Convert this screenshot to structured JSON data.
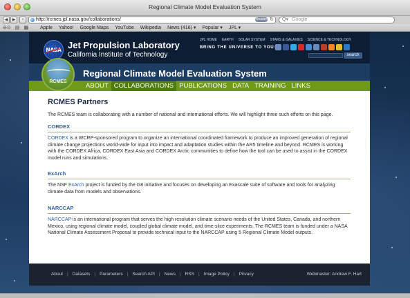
{
  "window": {
    "title": "Regional Climate Model Evaluation System"
  },
  "toolbar": {
    "url": "http://rcmes.jpl.nasa.gov/collaborations/",
    "reader_label": "Reader",
    "search_placeholder": "Google"
  },
  "bookmarks": [
    "Apple",
    "Yahoo!",
    "Google Maps",
    "YouTube",
    "Wikipedia",
    "News (416) ▾",
    "Popular ▾",
    "JPL ▾"
  ],
  "jpl": {
    "logo_text": "NASA",
    "title": "Jet Propulsion Laboratory",
    "subtitle": "California Institute of Technology",
    "top_links": [
      "JPL HOME",
      "EARTH",
      "SOLAR SYSTEM",
      "STARS & GALAXIES",
      "SCIENCE & TECHNOLOGY"
    ],
    "tagline": "BRING THE UNIVERSE TO YOU:",
    "search_button": "search"
  },
  "rcmes": {
    "logo_text": "RCMES",
    "title": "Regional Climate Model Evaluation System",
    "nav": [
      "ABOUT",
      "COLLABORATIONS",
      "PUBLICATIONS",
      "DATA",
      "TRAINING",
      "LINKS"
    ],
    "active_nav": "COLLABORATIONS"
  },
  "content": {
    "heading": "RCMES Partners",
    "intro": "The RCMES team is collaborating with a number of national and international efforts. We will highlight three such efforts on this page.",
    "cordex": {
      "title": "CORDEX",
      "link": "CORDEX",
      "text": " is a WCRP-sponsored program to organize an international coordinated framework to produce an improved generation of regional climate change projections world-wide for input into impact and adaptation studies within the AR5 timeline and beyond. RCMES is working with the CORDEX Africa, CORDEX East Asia and CORDEX Arctic communities to define how the tool can be used to assist in the CORDEX model runs and simulations."
    },
    "exarch": {
      "title": "ExArch",
      "pre": "The NSF ",
      "link": "ExArch",
      "text": " project is funded by the G8 initiative and focuses on developing an Exascale suite of software and tools for analyzing climate data from models and observations."
    },
    "narccap": {
      "title": "NARCCAP",
      "link": "NARCCAP",
      "text": " is an international program that serves the high resolution climate scenario needs of the United States, Canada, and northern Mexico, using regional climate model, coupled global climate model, and time-slice experiments. The RCMES team is funded under a NASA National Climate Assessment Proposal to provide technical input to the NARCCAP using 5 Regional Climate Model outputs."
    }
  },
  "footer": {
    "links": [
      "About",
      "Datasets",
      "Parameters",
      "Search API",
      "News",
      "RSS",
      "Image Policy",
      "Privacy"
    ],
    "webmaster": "Webmaster: Andrew F. Hart"
  },
  "colors": {
    "nav_green": "#6e9a17",
    "banner_blue": "#1d3c62",
    "section_rule": "#e59a3a",
    "link_blue": "#2c5fa9"
  }
}
